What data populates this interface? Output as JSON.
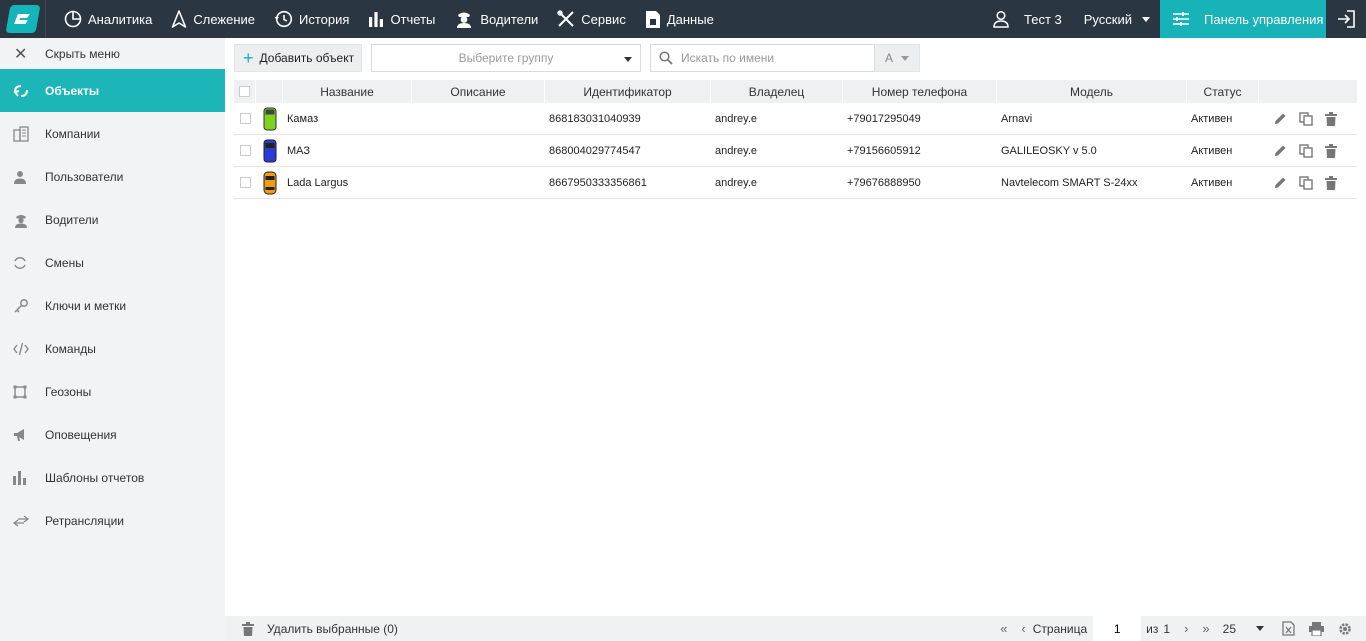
{
  "topnav": {
    "items": [
      {
        "label": "Аналитика",
        "icon": "analytics-icon"
      },
      {
        "label": "Слежение",
        "icon": "tracking-icon"
      },
      {
        "label": "История",
        "icon": "history-icon"
      },
      {
        "label": "Отчеты",
        "icon": "reports-icon"
      },
      {
        "label": "Водители",
        "icon": "drivers-icon"
      },
      {
        "label": "Сервис",
        "icon": "service-icon"
      },
      {
        "label": "Данные",
        "icon": "data-icon"
      }
    ],
    "user": "Тест 3",
    "language": "Русский",
    "control_panel": "Панель управления"
  },
  "sidebar": {
    "hide_menu": "Скрыть меню",
    "items": [
      {
        "label": "Объекты",
        "active": true
      },
      {
        "label": "Компании"
      },
      {
        "label": "Пользователи"
      },
      {
        "label": "Водители"
      },
      {
        "label": "Смены"
      },
      {
        "label": "Ключи и метки"
      },
      {
        "label": "Команды"
      },
      {
        "label": "Геозоны"
      },
      {
        "label": "Оповещения"
      },
      {
        "label": "Шаблоны отчетов"
      },
      {
        "label": "Ретрансляции"
      }
    ]
  },
  "toolbar": {
    "add_object": "Добавить объект",
    "group_placeholder": "Выберите группу",
    "search_placeholder": "Искать по имени",
    "sort_label": "А"
  },
  "table": {
    "columns": [
      "Название",
      "Описание",
      "Идентификатор",
      "Владелец",
      "Номер телефона",
      "Модель",
      "Статус"
    ],
    "rows": [
      {
        "name": "Камаз",
        "description": "",
        "identifier": "868183031040939",
        "owner": "andrey.e",
        "phone": "+79017295049",
        "model": "Arnavi",
        "status": "Активен",
        "vehicle_color": "#7ed321"
      },
      {
        "name": "МАЗ",
        "description": "",
        "identifier": "868004029774547",
        "owner": "andrey.e",
        "phone": "+79156605912",
        "model": "GALILEOSKY v 5.0",
        "status": "Активен",
        "vehicle_color": "#2a3bd6"
      },
      {
        "name": "Lada Largus",
        "description": "",
        "identifier": "8667950333356861",
        "owner": "andrey.e",
        "phone": "+79676888950",
        "model": "Navtelecom SMART S-24xx",
        "status": "Активен",
        "vehicle_color": "#f39c12"
      }
    ]
  },
  "footer": {
    "delete_selected": "Удалить выбранные (0)",
    "page_label": "Страница",
    "page_value": "1",
    "of_label": "из",
    "total_pages": "1",
    "page_size": "25"
  }
}
